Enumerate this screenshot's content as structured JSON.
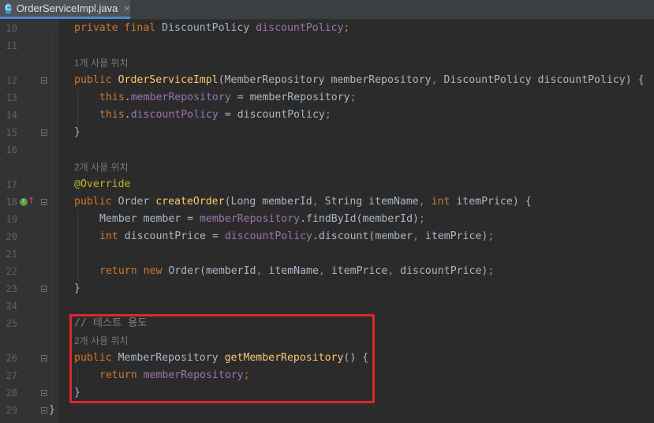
{
  "tab": {
    "icon_letter": "C",
    "filename": "OrderServiceImpl.java",
    "close": "×"
  },
  "gutter": {
    "line_numbers": [
      "10",
      "11",
      "12",
      "13",
      "14",
      "15",
      "16",
      "17",
      "18",
      "19",
      "20",
      "21",
      "22",
      "23",
      "24",
      "25",
      "26",
      "27",
      "28",
      "29"
    ]
  },
  "hints": {
    "h1": "1개 사용 위치",
    "h2": "2개 사용 위치",
    "h3": "2개 사용 위치"
  },
  "code": {
    "l10": {
      "kw": "private final ",
      "type": "DiscountPolicy ",
      "field": "discountPolicy",
      "semi": ";"
    },
    "l12": {
      "kw": "public ",
      "name": "OrderServiceImpl",
      "params": "(MemberRepository memberRepository",
      "comma": ", ",
      "params2": "DiscountPolicy discountPolicy) {"
    },
    "l13": {
      "this": "this",
      "dot": ".",
      "field": "memberRepository",
      "rest": " = memberRepository",
      "semi": ";"
    },
    "l14": {
      "this": "this",
      "dot": ".",
      "field": "discountPolicy",
      "rest": " = discountPolicy",
      "semi": ";"
    },
    "l15": "}",
    "l17": "@Override",
    "l18": {
      "kw": "public ",
      "type": "Order ",
      "name": "createOrder",
      "p1": "(Long memberId",
      "c1": ", ",
      "p2": "String itemName",
      "c2": ", ",
      "kw2": "int ",
      "p3": "itemPrice) {"
    },
    "l19": {
      "type": "Member member = ",
      "field": "memberRepository",
      "rest": ".findById(memberId)",
      "semi": ";"
    },
    "l20": {
      "kw": "int ",
      "var": "discountPrice = ",
      "field": "discountPolicy",
      "rest1": ".discount(member",
      "c": ", ",
      "rest2": "itemPrice)",
      "semi": ";"
    },
    "l22": {
      "kw": "return new ",
      "call": "Order(memberId",
      "c1": ", ",
      "a2": "itemName",
      "c2": ", ",
      "a3": "itemPrice",
      "c3": ", ",
      "a4": "discountPrice)",
      "semi": ";"
    },
    "l23": "}",
    "l25": "// 테스트 용도",
    "l26": {
      "kw": "public ",
      "type": "MemberRepository ",
      "name": "getMemberRepository",
      "rest": "() {"
    },
    "l27": {
      "kw": "return ",
      "field": "memberRepository",
      "semi": ";"
    },
    "l28": "}",
    "l29": "}"
  },
  "colors": {
    "background": "#2b2b2b",
    "keyword": "#cc7832",
    "field": "#9876aa",
    "method": "#ffc66d",
    "annotation": "#bbb529",
    "highlight_box": "#e0262f"
  }
}
